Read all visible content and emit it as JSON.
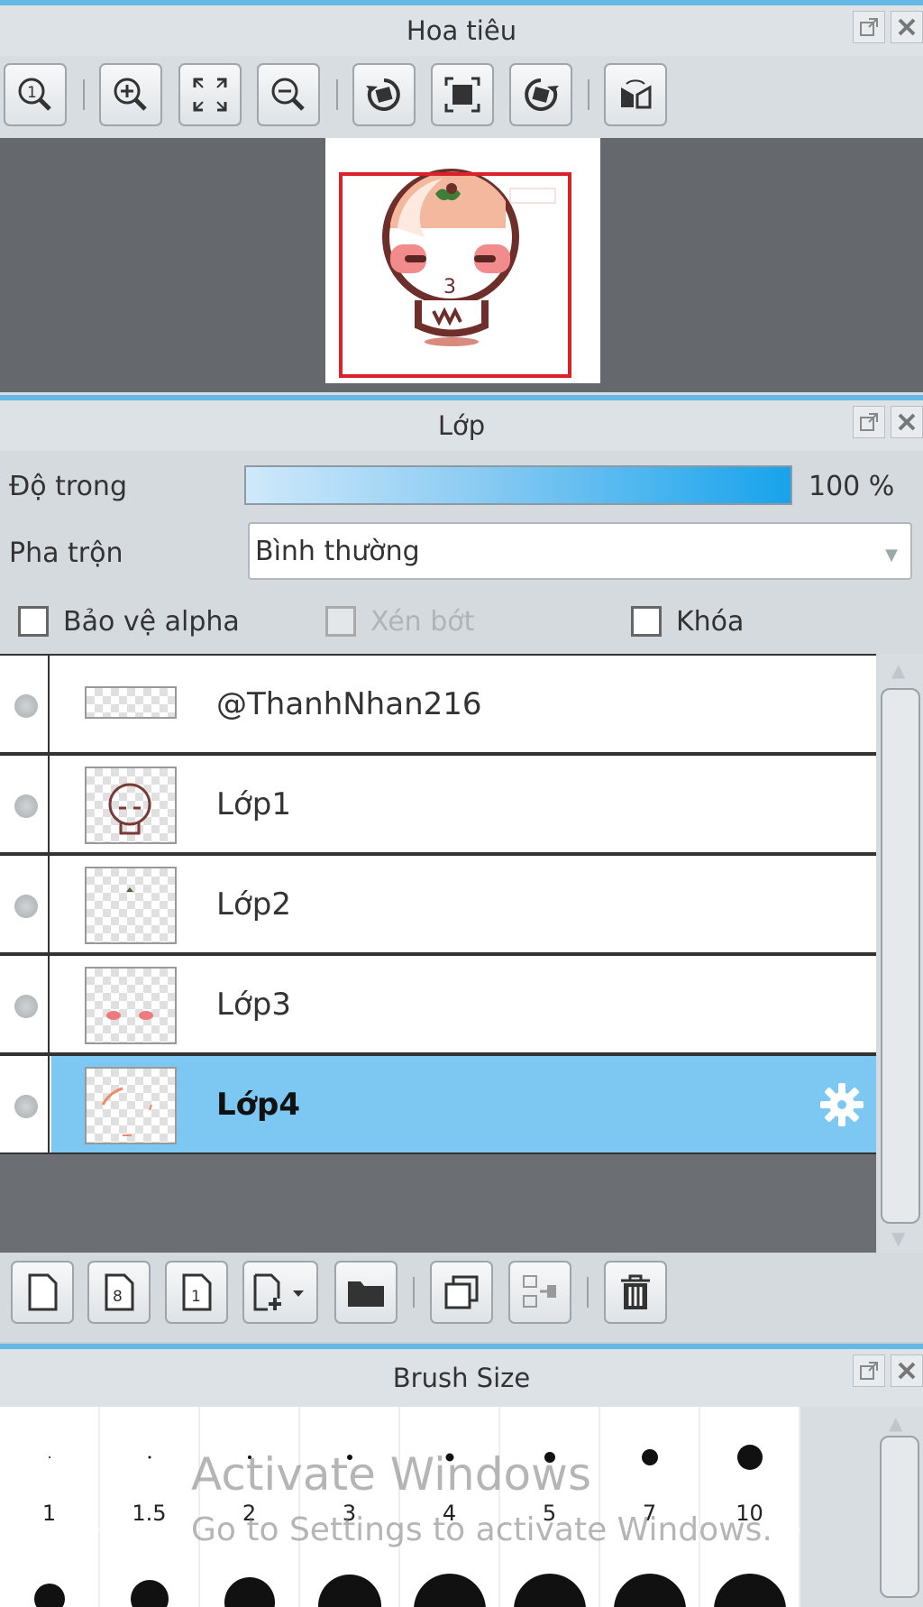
{
  "navigator": {
    "title": "Hoa tiêu",
    "preview_text": "3"
  },
  "layers_panel": {
    "title": "Lớp",
    "opacity_label": "Độ trong",
    "opacity_value": "100 %",
    "opacity_fraction": 1.0,
    "blend_label": "Pha trộn",
    "blend_value": "Bình thường",
    "protect_alpha_label": "Bảo vệ alpha",
    "clipping_label": "Xén bớt",
    "lock_label": "Khóa",
    "layers": [
      {
        "name": "@ThanhNhan216",
        "selected": false
      },
      {
        "name": "Lớp1",
        "selected": false
      },
      {
        "name": "Lớp2",
        "selected": false
      },
      {
        "name": "Lớp3",
        "selected": false
      },
      {
        "name": "Lớp4",
        "selected": true
      }
    ]
  },
  "brush_panel": {
    "title": "Brush Size",
    "sizes": [
      "1",
      "1.5",
      "2",
      "3",
      "4",
      "5",
      "7",
      "10"
    ]
  },
  "watermark": {
    "line1": "Activate Windows",
    "line2": "Go to Settings to activate Windows."
  },
  "colors": {
    "accent_blue": "#63b8e6",
    "selected_row": "#7cc8f3",
    "view_rect_red": "#d8232a",
    "canvas_gray": "#65686c"
  }
}
